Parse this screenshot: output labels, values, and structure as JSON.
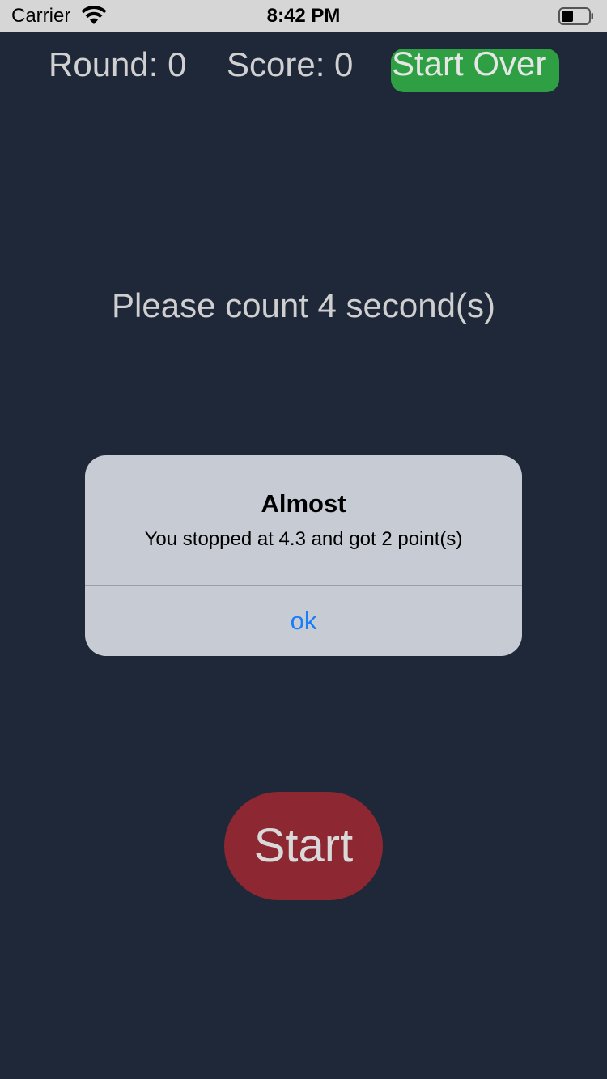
{
  "status_bar": {
    "carrier": "Carrier",
    "time": "8:42 PM",
    "wifi_icon": "wifi-icon",
    "battery_icon": "battery-icon"
  },
  "header": {
    "round_label": "Round: 0",
    "score_label": "Score: 0",
    "start_over_label": "Start Over",
    "start_over_color": "#2ea043"
  },
  "main": {
    "prompt": "Please count 4 second(s)",
    "start_label": "Start",
    "start_color": "#8d2731"
  },
  "alert": {
    "title": "Almost",
    "message": "You stopped at 4.3 and got 2 point(s)",
    "ok_label": "ok",
    "ok_color": "#1a7ef6"
  },
  "colors": {
    "background": "#1f2839"
  }
}
